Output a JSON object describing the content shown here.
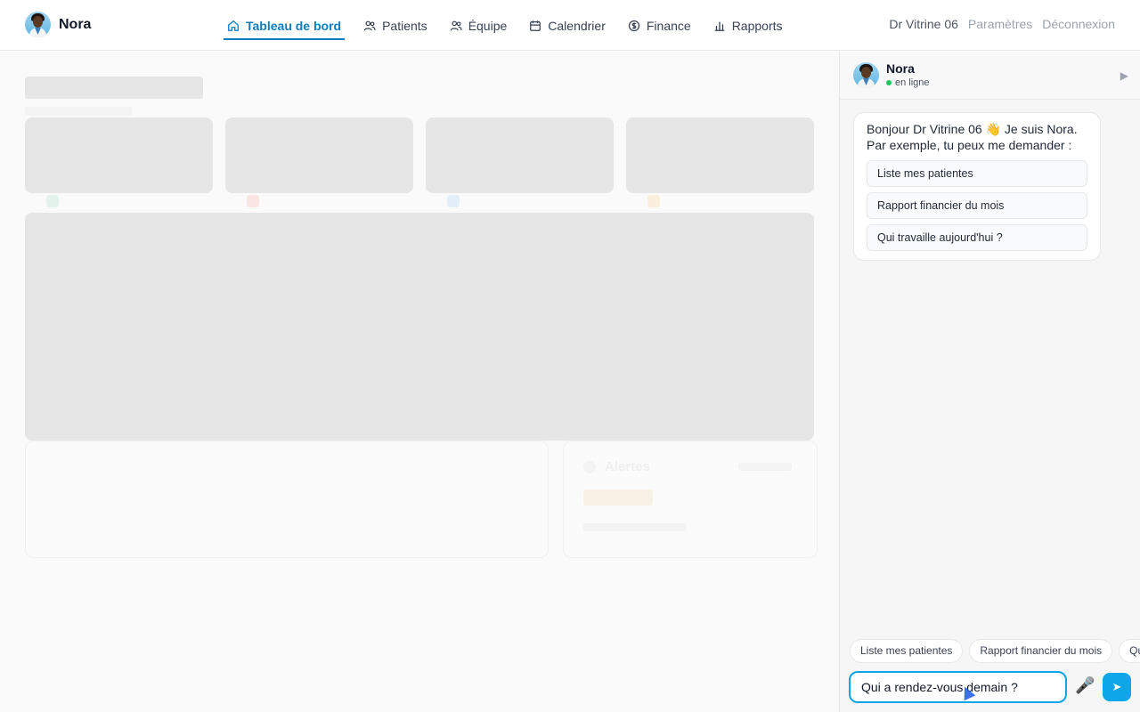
{
  "brand": {
    "name": "Nora"
  },
  "nav": {
    "items": [
      {
        "label": "Tableau de bord",
        "icon": "home-icon",
        "active": true
      },
      {
        "label": "Patients",
        "icon": "users-icon"
      },
      {
        "label": "Équipe",
        "icon": "team-icon"
      },
      {
        "label": "Calendrier",
        "icon": "calendar-icon"
      },
      {
        "label": "Finance",
        "icon": "dollar-icon"
      },
      {
        "label": "Rapports",
        "icon": "bar-chart-icon"
      }
    ]
  },
  "top_right": {
    "user": "Dr Vitrine 06",
    "settings": "Paramètres",
    "logout": "Déconnexion"
  },
  "chat": {
    "name": "Nora",
    "status": "en ligne",
    "greeting": "Bonjour Dr Vitrine 06 👋 Je suis Nora. Par exemple, tu peux me demander :",
    "suggestions": [
      "Liste mes patientes",
      "Rapport financier du mois",
      "Qui travaille aujourd'hui ?"
    ],
    "chips": [
      "Liste mes patientes",
      "Rapport financier du mois",
      "Qui travaille aujourd'hui ?"
    ],
    "input_value": "Qui a rendez-vous demain ?",
    "mic_icon": "🎤",
    "send_icon": "➤",
    "collapse_icon": "▶"
  },
  "background": {
    "alerts_label": "Alertes"
  },
  "colors": {
    "accent": "#0e7cc2",
    "send": "#0ea5e9",
    "online": "#22c55e",
    "skeleton": "#e6e6e6"
  }
}
